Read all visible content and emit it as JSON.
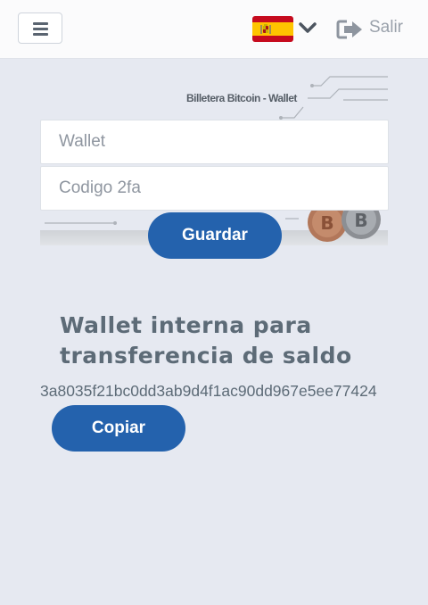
{
  "header": {
    "menu_icon": "hamburger-icon",
    "language_flag": "spain-flag-icon",
    "language_dropdown_icon": "chevron-down-icon",
    "logout_icon": "sign-out-icon",
    "logout_label": "Salir"
  },
  "banner": {
    "title": "Billetera Bitcoin - Wallet"
  },
  "form": {
    "wallet_placeholder": "Wallet",
    "code_placeholder": "Codigo 2fa",
    "save_label": "Guardar"
  },
  "internal_wallet": {
    "heading": "Wallet interna para transferencia de saldo",
    "address": "3a8035f21bc0dd3ab9d4f1ac90dd967e5ee77424",
    "copy_label": "Copiar"
  },
  "colors": {
    "primary_button": "#2462ad",
    "background": "#e6e9f1",
    "text_muted": "#5d6b77"
  }
}
